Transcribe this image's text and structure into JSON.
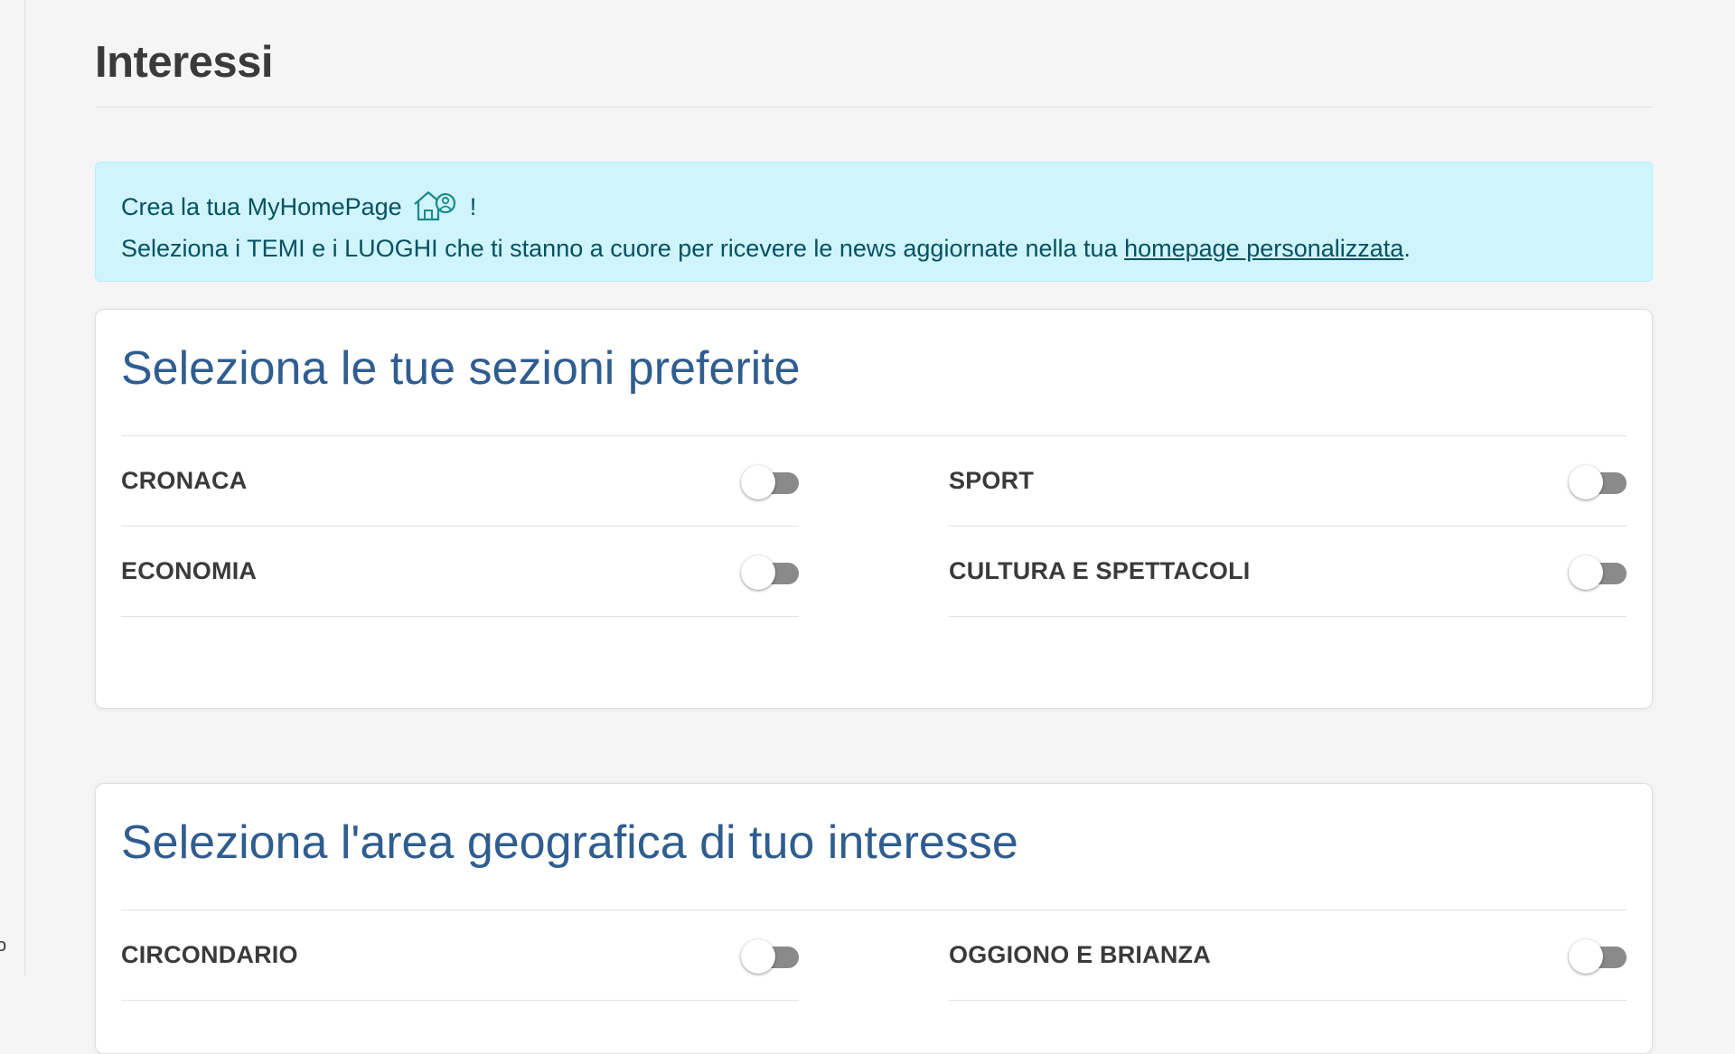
{
  "page": {
    "title": "Interessi"
  },
  "info": {
    "line1_text": "Crea la tua MyHomePage",
    "line1_suffix": "!",
    "icon": "house-user-icon",
    "line2_text": "Seleziona i TEMI e i LUOGHI che ti stanno a cuore per ricevere le news aggiornate nella tua ",
    "line2_link": "homepage personalizzata",
    "line2_end": "."
  },
  "sections": {
    "title": "Seleziona le tue sezioni preferite",
    "items": [
      {
        "label": "CRONACA",
        "on": false
      },
      {
        "label": "SPORT",
        "on": false
      },
      {
        "label": "ECONOMIA",
        "on": false
      },
      {
        "label": "CULTURA E SPETTACOLI",
        "on": false
      }
    ]
  },
  "geo": {
    "title": "Seleziona l'area geografica di tuo interesse",
    "items": [
      {
        "label": "CIRCONDARIO",
        "on": false
      },
      {
        "label": "OGGIONO E BRIANZA",
        "on": false
      }
    ]
  },
  "colors": {
    "info_bg": "#cff4fc",
    "info_text": "#055160",
    "card_title": "#2f5d8f",
    "toggle_off_track": "#8a8a8a"
  },
  "left_rail": {
    "edge_glyph": "o"
  }
}
